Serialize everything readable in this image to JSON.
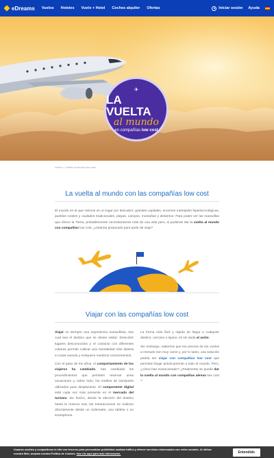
{
  "header": {
    "brand": "eDreams",
    "nav": [
      "Vuelos",
      "Hoteles",
      "Vuelo + Hotel",
      "Coches alquiler",
      "Ofertas"
    ],
    "login_label": "Iniciar sesión",
    "help_label": "Ayuda",
    "colors": {
      "bar": "#0b3fb8",
      "logo_mark": "#ffcc00"
    }
  },
  "hero": {
    "badge_line1": "LA VUELTA",
    "badge_line2": "al mundo",
    "badge_line3_prefix": "en compañías ",
    "badge_line3_bold": "low cost",
    "badge_icon": "airplane-icon"
  },
  "breadcrumb": "Home > Vuelta al mundo low cost",
  "section1": {
    "title": "La vuelta al mundo con las compañías low cost",
    "intro_text": "El mundo en el que vivimos es un lugar por descubrir: grandes capitales, enormes metrópolis hipertecnológicas, pueblos rurales y ciudades tradicionales, playas, campos, montañas y desiertos. Para poder ver las maravillas que ofrece la Tierra, probablemente necesitaríamos más de una vida pero, si pudieras dar la ",
    "intro_bold": "vuelta al mundo con compañías",
    "intro_end": " low cost, ¿estarías preparado para partir de viaje?"
  },
  "section2": {
    "title": "Viajar con las compañías low cost",
    "left": {
      "p1_bold": "Viajar",
      "p1": " es siempre una experiencia maravillosa, sea cual sea el destino que se desee visitar. Descubrir lugares desconocidos y el contacto con diferentes culturas permite cultivar una mentalidad más abierta a cosas nuevas y enriquece nuestros conocimientos.",
      "p2_a": "Con el paso de los años, el ",
      "p2_bold1": "comportamiento de los viajeros ha cambiado",
      "p2_b": ", han cambiado los procedimientos que permiten reservar unas vacaciones y, sobre todo, los medios de transporte utilizados para desplazarse. El ",
      "p2_bold2": "componente digital",
      "p2_c": " está cada vez más presente en el ",
      "p2_bold3": "mercado del turismo",
      "p2_d": ". De hecho, desde la elección del destino hasta la reserva real, las transacciones se realizan directamente desde un ordenador, una tableta o un smartphone."
    },
    "right": {
      "p1": "La forma más fácil y rápida de llegar a cualquier destino, cercano o lejano, es sin duda ",
      "p1_bold": "el avión",
      "p1_end": ".",
      "p2_a": "Sin embargo, sabemos que los precios de los vuelos a menudo son muy caros y, por lo tanto, una solución podría ser ",
      "p2_link": "viajar con compañías low cost",
      "p2_b": " que permitan llegar prácticamente a todo el mundo. Pero, ¿cómo han evolucionado? ¿Realmente se puede ",
      "p2_bold": "dar la vuelta al mundo con compañías aéreas",
      "p2_c": " low cost ?"
    }
  },
  "cookie": {
    "text": "Usamos cookies y compartimos lo info con terceros para personalizar publicidad, analizar tráfico y ofrecer servicios relacionados con redes sociales. Al utilizar nuestra Web, aceptas nuestra Política de Cookies.",
    "link": "Haz clic aquí para más información.",
    "button": "Entendido"
  }
}
